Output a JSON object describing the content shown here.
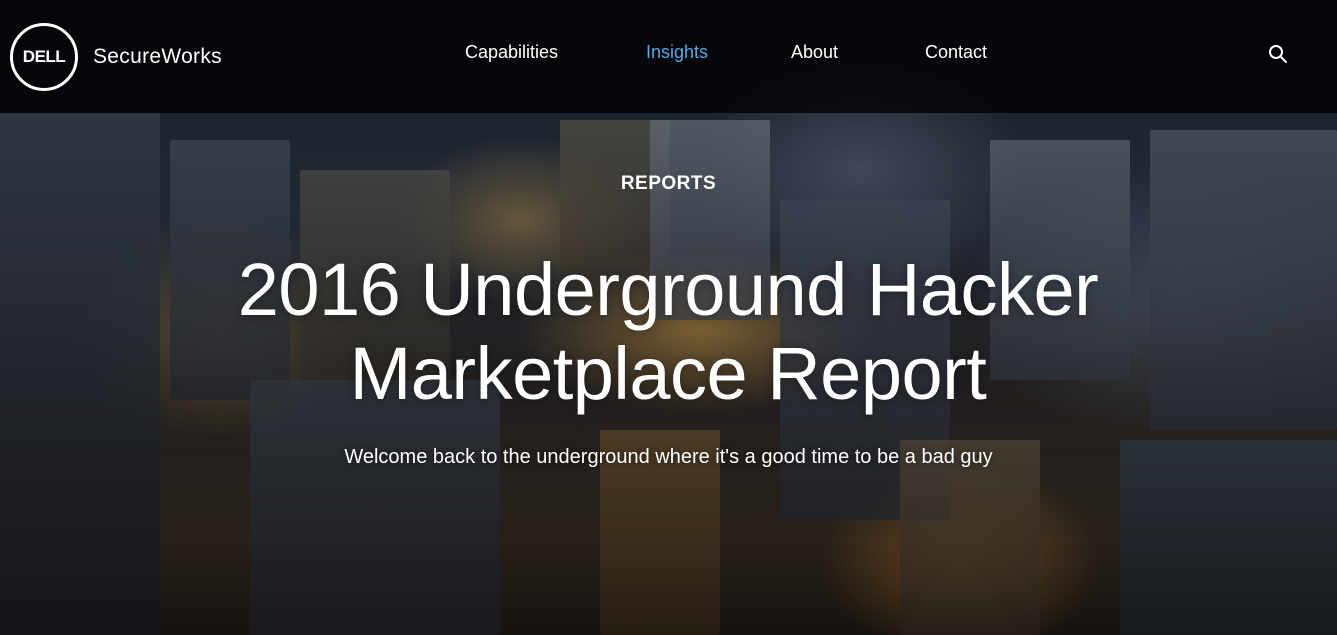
{
  "header": {
    "logo_badge_text": "DELL",
    "brand_name": "SecureWorks",
    "nav": [
      {
        "label": "Capabilities",
        "active": false
      },
      {
        "label": "Insights",
        "active": true
      },
      {
        "label": "About",
        "active": false
      },
      {
        "label": "Contact",
        "active": false
      }
    ],
    "search_icon": "search-icon"
  },
  "hero": {
    "eyebrow": "REPORTS",
    "title": "2016 Underground Hacker Marketplace Report",
    "subtitle": "Welcome back to the underground where it's a good time to be a bad guy",
    "background": "aerial-city-night-photo"
  },
  "colors": {
    "header_bg": "#000000",
    "active_nav": "#59a7e0",
    "text": "#ffffff"
  }
}
